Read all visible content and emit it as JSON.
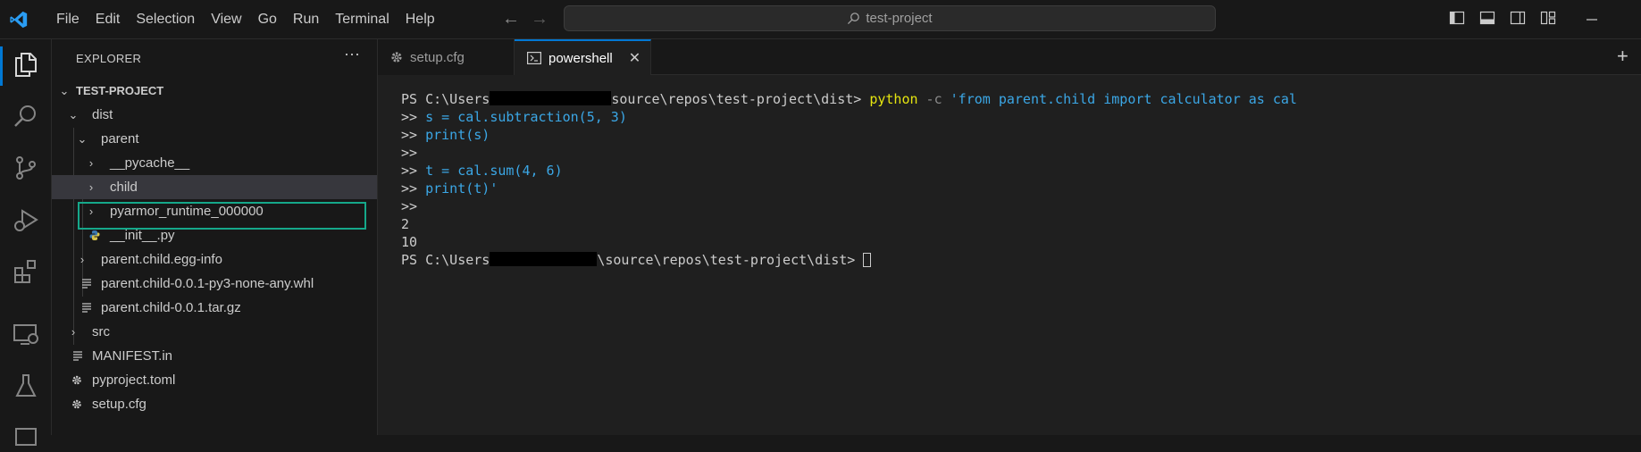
{
  "menu": [
    "File",
    "Edit",
    "Selection",
    "View",
    "Go",
    "Run",
    "Terminal",
    "Help"
  ],
  "search": {
    "text": "test-project"
  },
  "explorer": {
    "title": "EXPLORER",
    "more": "···",
    "root": "TEST-PROJECT",
    "items": [
      {
        "label": "dist",
        "kind": "folder-open"
      },
      {
        "label": "parent",
        "kind": "folder-open"
      },
      {
        "label": "__pycache__",
        "kind": "folder-closed"
      },
      {
        "label": "child",
        "kind": "folder-closed"
      },
      {
        "label": "pyarmor_runtime_000000",
        "kind": "folder-closed"
      },
      {
        "label": "__init__.py",
        "kind": "python-file"
      },
      {
        "label": "parent.child.egg-info",
        "kind": "folder-closed"
      },
      {
        "label": "parent.child-0.0.1-py3-none-any.whl",
        "kind": "file"
      },
      {
        "label": "parent.child-0.0.1.tar.gz",
        "kind": "file"
      },
      {
        "label": "src",
        "kind": "folder-closed"
      },
      {
        "label": "MANIFEST.in",
        "kind": "file"
      },
      {
        "label": "pyproject.toml",
        "kind": "settings-file"
      },
      {
        "label": "setup.cfg",
        "kind": "settings-file"
      }
    ]
  },
  "tabs": [
    {
      "label": "setup.cfg",
      "active": false
    },
    {
      "label": "powershell",
      "active": true
    }
  ],
  "terminal": {
    "line1_ps": "PS C:\\Users",
    "line1_path": "source\\repos\\test-project\\dist> ",
    "line1_cmd": "python",
    "line1_flag": " -c ",
    "line1_str": "'from parent.child import calculator as cal",
    "prompt_cont": ">> ",
    "line2": "s = cal.subtraction(5, 3)",
    "line3": "print(s)",
    "line5": "t = cal.sum(4, 6)",
    "line6": "print(t)'",
    "out1": "2",
    "out2": "10",
    "line10_ps": "PS C:\\Users",
    "line10_path": "\\source\\repos\\test-project\\dist> "
  },
  "colors": {
    "accent": "#0078d4",
    "highlight_box": "#15a88a",
    "terminal_code": "#3ba7e6",
    "terminal_command": "#e5e510"
  }
}
